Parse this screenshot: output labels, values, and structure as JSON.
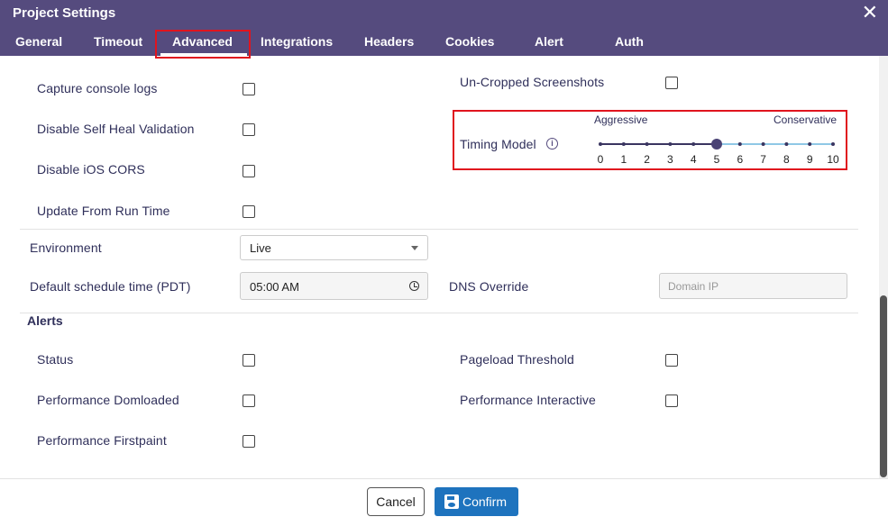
{
  "dialog": {
    "title": "Project Settings",
    "close_label": "✕"
  },
  "tabs": [
    "General",
    "Timeout",
    "Advanced",
    "Integrations",
    "Headers",
    "Cookies",
    "Alert",
    "Auth"
  ],
  "active_tab": "Advanced",
  "options": {
    "capture_console_logs": "Capture console logs",
    "disable_self_heal": "Disable Self Heal Validation",
    "disable_ios_cors": "Disable iOS CORS",
    "update_from_run_time": "Update From Run Time",
    "uncropped_screenshots": "Un-Cropped Screenshots"
  },
  "timing_model": {
    "label": "Timing Model",
    "info_glyph": "i",
    "min_label": "Aggressive",
    "max_label": "Conservative",
    "ticks": [
      "0",
      "1",
      "2",
      "3",
      "4",
      "5",
      "6",
      "7",
      "8",
      "9",
      "10"
    ],
    "value": 5
  },
  "environment": {
    "label": "Environment",
    "value": "Live"
  },
  "schedule": {
    "label": "Default schedule time (PDT)",
    "value": "05:00 AM"
  },
  "dns": {
    "label": "DNS Override",
    "placeholder": "Domain IP"
  },
  "alerts": {
    "title": "Alerts",
    "status": "Status",
    "pageload_threshold": "Pageload Threshold",
    "performance_domloaded": "Performance Domloaded",
    "performance_interactive": "Performance Interactive",
    "performance_firstpaint": "Performance Firstpaint"
  },
  "footer": {
    "cancel_label": "Cancel",
    "confirm_label": "Confirm"
  },
  "colors": {
    "header": "#554b7e",
    "accent": "#1e73be",
    "highlight": "#e0141e"
  }
}
